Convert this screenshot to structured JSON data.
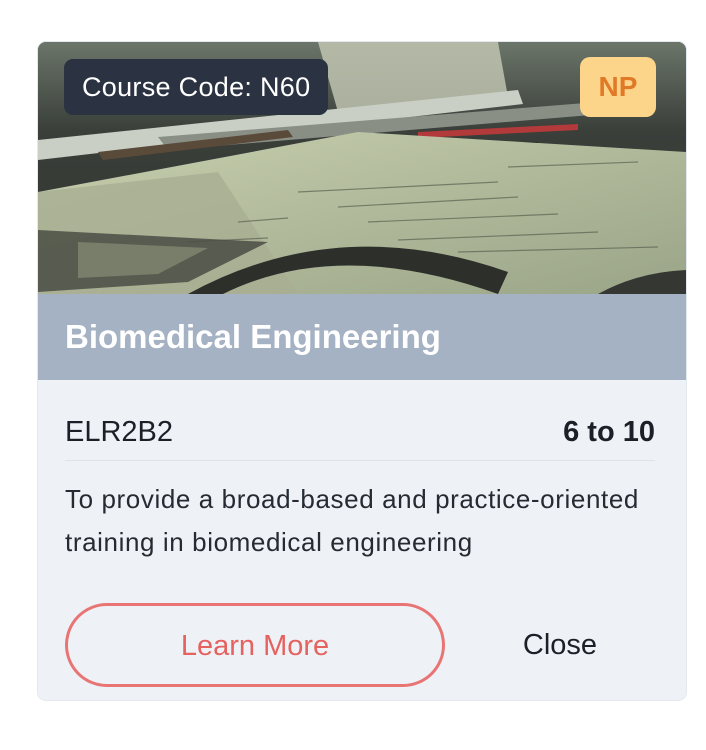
{
  "card": {
    "course_code": "Course Code: N60",
    "level_badge": "NP",
    "title": "Biomedical Engineering",
    "code": "ELR2B2",
    "range": "6 to 10",
    "description": "To provide a broad-based and practice-oriented training in biomedical engineering",
    "learn_more_label": "Learn More",
    "close_label": "Close",
    "image_subject": "engineering drawings on a drafting table",
    "colors": {
      "title_bar": "#a4b2c3",
      "badge_dark": "#2b3242",
      "badge_level_bg": "#fcd48a",
      "badge_level_text": "#e07a27",
      "accent": "#e87574",
      "card_bg": "#eef2f7"
    }
  }
}
